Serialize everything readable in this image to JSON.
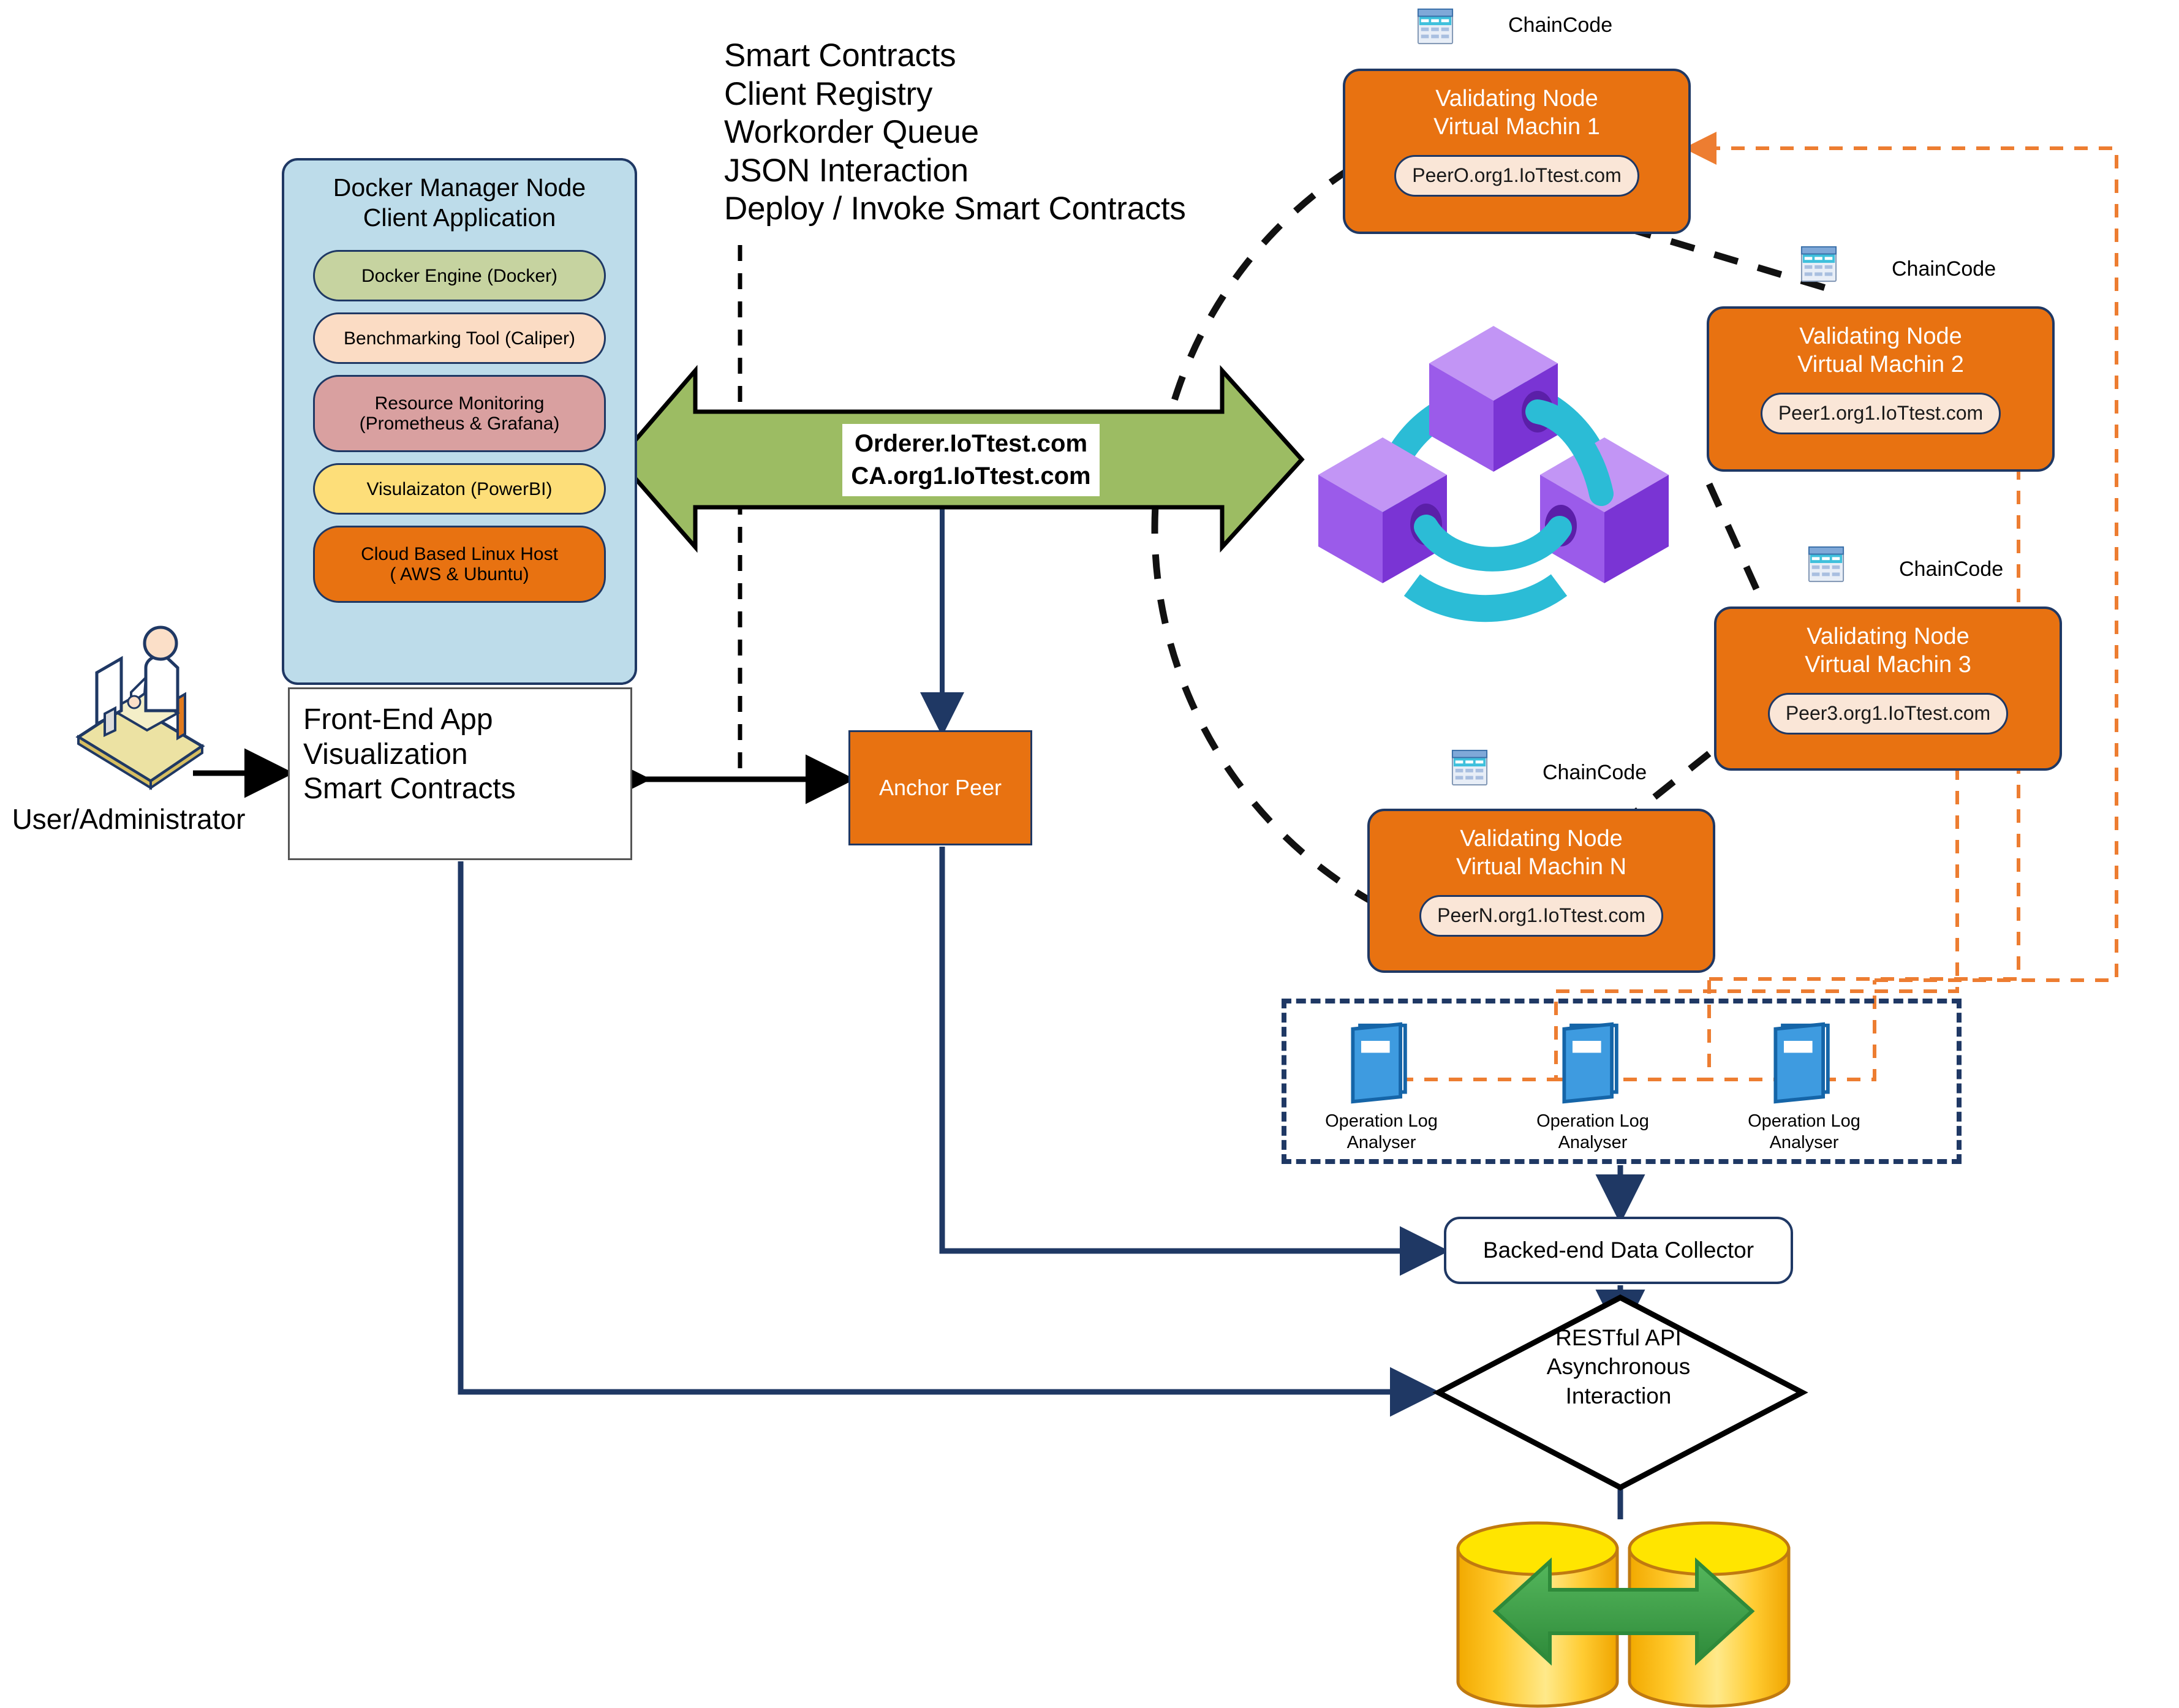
{
  "feature_list": [
    "Smart Contracts",
    "Client Registry",
    "Workorder Queue",
    "JSON Interaction",
    "Deploy / Invoke Smart Contracts"
  ],
  "docker_panel": {
    "title": "Docker Manager Node Client Application",
    "layers": [
      {
        "label": "Docker Engine (Docker)",
        "color": "#C6D3A0"
      },
      {
        "label": "Benchmarking Tool (Caliper)",
        "color": "#FBDCC4"
      },
      {
        "label": "Resource  Monitoring\n(Prometheus & Grafana)",
        "color": "#D9A0A0"
      },
      {
        "label": "Visulaizaton (PowerBI)",
        "color": "#FDDE79"
      },
      {
        "label": "Cloud Based Linux Host\n( AWS & Ubuntu)",
        "color": "#E87211"
      }
    ]
  },
  "frontend_box": {
    "lines": [
      "Front-End App",
      "Visualization",
      "Smart Contracts"
    ]
  },
  "user": {
    "label": "User/Administrator",
    "icon": "user-at-computer-icon"
  },
  "orderer_arrow": {
    "line1": "Orderer.IoTtest.com",
    "line2": "CA.org1.IoTtest.com",
    "color": "#9CBC63"
  },
  "anchor_peer": {
    "label": "Anchor Peer",
    "color": "#E87211"
  },
  "chaincode_label": "ChainCode",
  "validating_nodes": [
    {
      "title": "Validating Node\nVirtual Machin 1",
      "peer": "PeerO.org1.IoTtest.com"
    },
    {
      "title": "Validating Node\nVirtual Machin 2",
      "peer": "Peer1.org1.IoTtest.com"
    },
    {
      "title": "Validating Node\nVirtual Machin 3",
      "peer": "Peer3.org1.IoTtest.com"
    },
    {
      "title": "Validating Node\nVirtual Machin N",
      "peer": "PeerN.org1.IoTtest.com"
    }
  ],
  "blockchain_icon": {
    "name": "blockchain-cubes-icon",
    "cube_color": "#9B5BEA",
    "link_color": "#2BBCD6"
  },
  "operation_log_analysers": [
    {
      "label": "Operation Log\nAnalyser"
    },
    {
      "label": "Operation Log\nAnalyser"
    },
    {
      "label": "Operation Log\nAnalyser"
    }
  ],
  "backend_collector": {
    "label": "Backed-end Data Collector"
  },
  "rest_api": {
    "label": "RESTful API\nAsynchronous\nInteraction"
  },
  "database": {
    "name": "database-cylinders-icon",
    "cylinder_color": "#FFD700",
    "arrow_color": "#3C9B45"
  },
  "colors": {
    "orange": "#E87211",
    "panel_blue": "#BDDCEA",
    "navy": "#1F3864",
    "green_arrow": "#9CBC63",
    "feedback_orange": "#ED7D31"
  }
}
